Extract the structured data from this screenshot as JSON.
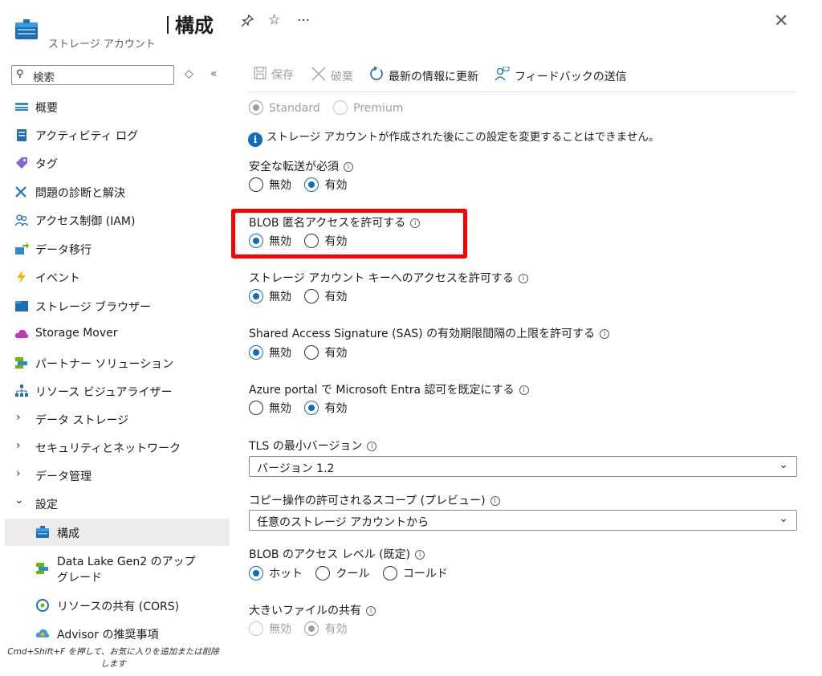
{
  "header": {
    "title": "構成",
    "subtitle": "ストレージ アカウント",
    "more": "···",
    "close": "✕"
  },
  "sidebar": {
    "search_placeholder": "検索",
    "items": [
      {
        "label": "概要"
      },
      {
        "label": "アクティビティ ログ"
      },
      {
        "label": "タグ"
      },
      {
        "label": "問題の診断と解決"
      },
      {
        "label": "アクセス制御 (IAM)"
      },
      {
        "label": "データ移行"
      },
      {
        "label": "イベント"
      },
      {
        "label": "ストレージ ブラウザー"
      },
      {
        "label": "Storage Mover"
      },
      {
        "label": "パートナー ソリューション"
      },
      {
        "label": "リソース ビジュアライザー"
      },
      {
        "label": "データ ストレージ"
      },
      {
        "label": "セキュリティとネットワーク"
      },
      {
        "label": "データ管理"
      },
      {
        "label": "設定"
      }
    ],
    "sub_items": [
      {
        "label": "構成"
      },
      {
        "label": "Data Lake Gen2 のアップ",
        "label2": "グレード"
      },
      {
        "label": "リソースの共有 (CORS)"
      },
      {
        "label": "Advisor の推奨事項"
      }
    ],
    "hint": "Cmd+Shift+F を押して、お気に入りを追加または削除します"
  },
  "toolbar": {
    "save": "保存",
    "discard": "破棄",
    "refresh": "最新の情報に更新",
    "feedback": "フィードバックの送信"
  },
  "form": {
    "performance": {
      "opt1": "Standard",
      "opt2": "Premium"
    },
    "note": "ストレージ アカウントが作成された後にこの設定を変更することはできません。",
    "secure_transfer": {
      "label": "安全な転送が必須",
      "opt1": "無効",
      "opt2": "有効"
    },
    "blob_anonymous": {
      "label": "BLOB 匿名アクセスを許可する",
      "opt1": "無効",
      "opt2": "有効"
    },
    "account_key": {
      "label": "ストレージ アカウント キーへのアクセスを許可する",
      "opt1": "無効",
      "opt2": "有効"
    },
    "sas": {
      "label": "Shared Access Signature (SAS) の有効期限間隔の上限を許可する",
      "opt1": "無効",
      "opt2": "有効"
    },
    "entra": {
      "label": "Azure portal で Microsoft Entra 認可を既定にする",
      "opt1": "無効",
      "opt2": "有効"
    },
    "tls": {
      "label": "TLS の最小バージョン",
      "value": "バージョン 1.2"
    },
    "copy_scope": {
      "label": "コピー操作の許可されるスコープ (プレビュー)",
      "value": "任意のストレージ アカウントから"
    },
    "access_tier": {
      "label": "BLOB のアクセス レベル (既定)",
      "opt1": "ホット",
      "opt2": "クール",
      "opt3": "コールド"
    },
    "large_file": {
      "label": "大きいファイルの共有",
      "opt1": "無効",
      "opt2": "有効"
    }
  },
  "colors": {
    "accent": "#0f6cbd",
    "highlight": "#ff0000"
  }
}
